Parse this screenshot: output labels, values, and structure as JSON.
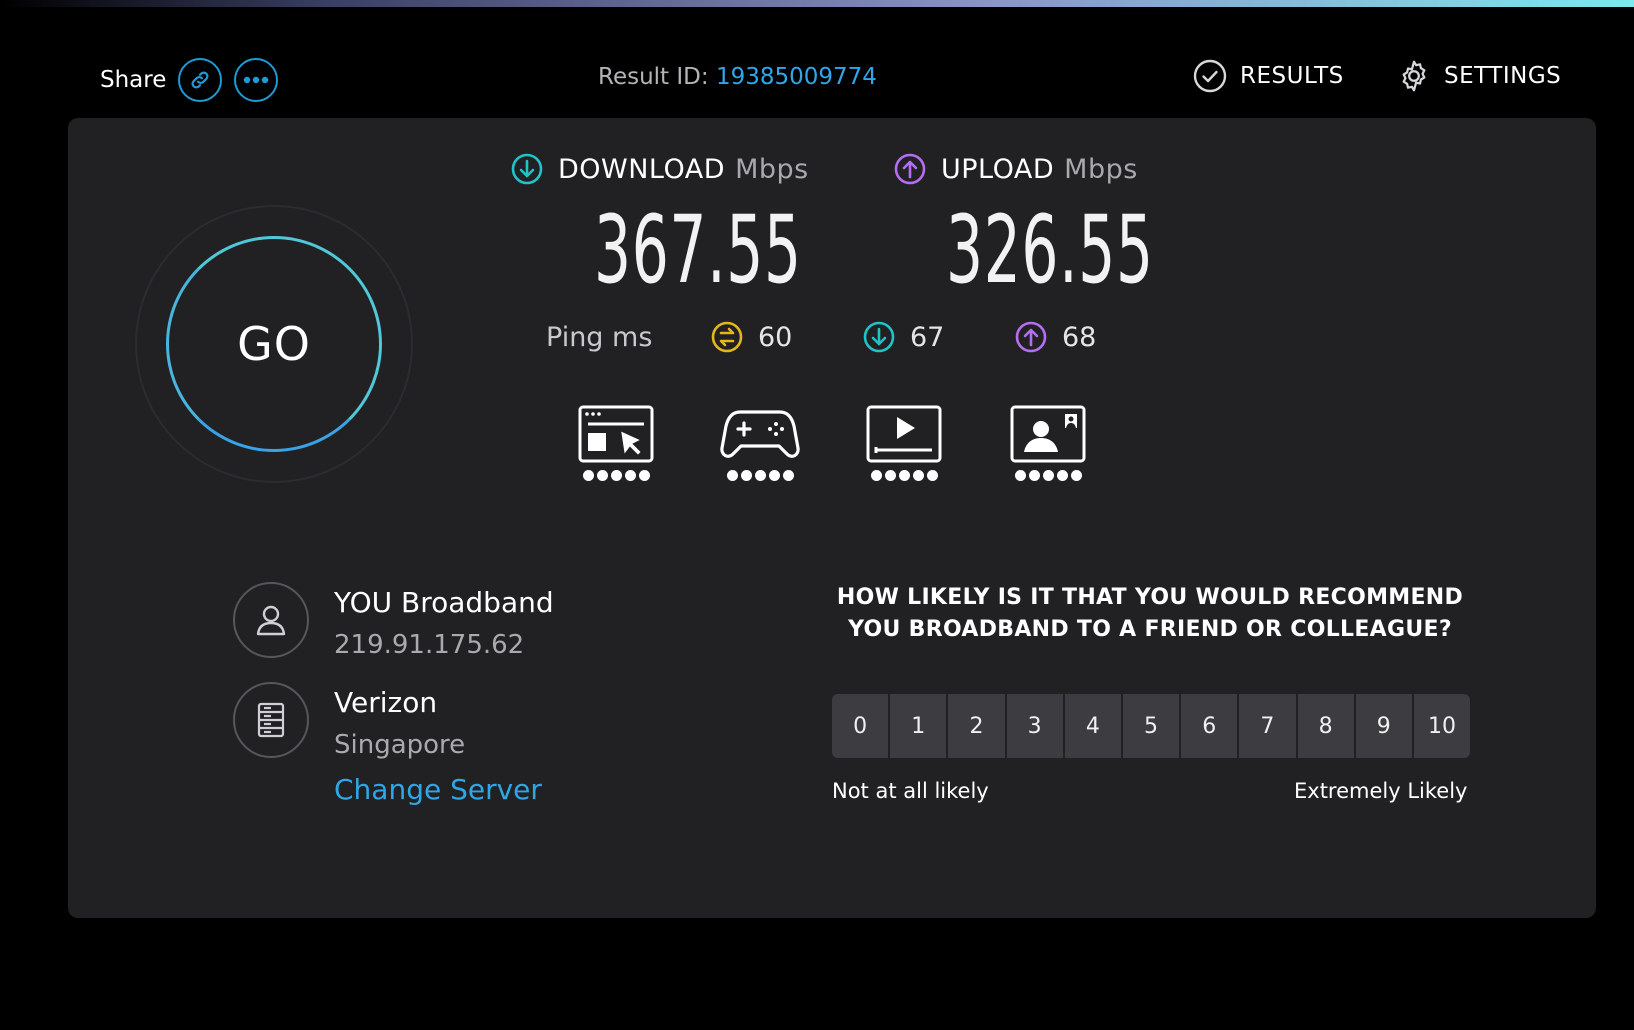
{
  "header": {
    "share_label": "Share",
    "result_id_label": "Result ID:",
    "result_id": "19385009774",
    "results_label": "RESULTS",
    "settings_label": "SETTINGS"
  },
  "go_label": "GO",
  "download": {
    "label": "DOWNLOAD",
    "unit": "Mbps",
    "value": "367.55"
  },
  "upload": {
    "label": "UPLOAD",
    "unit": "Mbps",
    "value": "326.55"
  },
  "ping": {
    "label": "Ping ms",
    "idle": "60",
    "download": "67",
    "upload": "68"
  },
  "app_ratings": [
    {
      "icon": "web-browsing-icon",
      "rating": 5
    },
    {
      "icon": "gaming-icon",
      "rating": 5
    },
    {
      "icon": "video-streaming-icon",
      "rating": 5
    },
    {
      "icon": "video-chat-icon",
      "rating": 5
    }
  ],
  "provider": {
    "name": "YOU Broadband",
    "ip": "219.91.175.62"
  },
  "server": {
    "name": "Verizon",
    "location": "Singapore",
    "change_label": "Change Server"
  },
  "survey": {
    "question": "HOW LIKELY IS IT THAT YOU WOULD RECOMMEND YOU BROADBAND TO A FRIEND OR COLLEAGUE?",
    "options": [
      "0",
      "1",
      "2",
      "3",
      "4",
      "5",
      "6",
      "7",
      "8",
      "9",
      "10"
    ],
    "low_label": "Not at all likely",
    "high_label": "Extremely Likely"
  },
  "colors": {
    "accent_link": "#2ea6e8",
    "download": "#1fc3c8",
    "upload": "#b36ef2",
    "idle_ping": "#e3b71b",
    "panel_bg": "#212124"
  }
}
